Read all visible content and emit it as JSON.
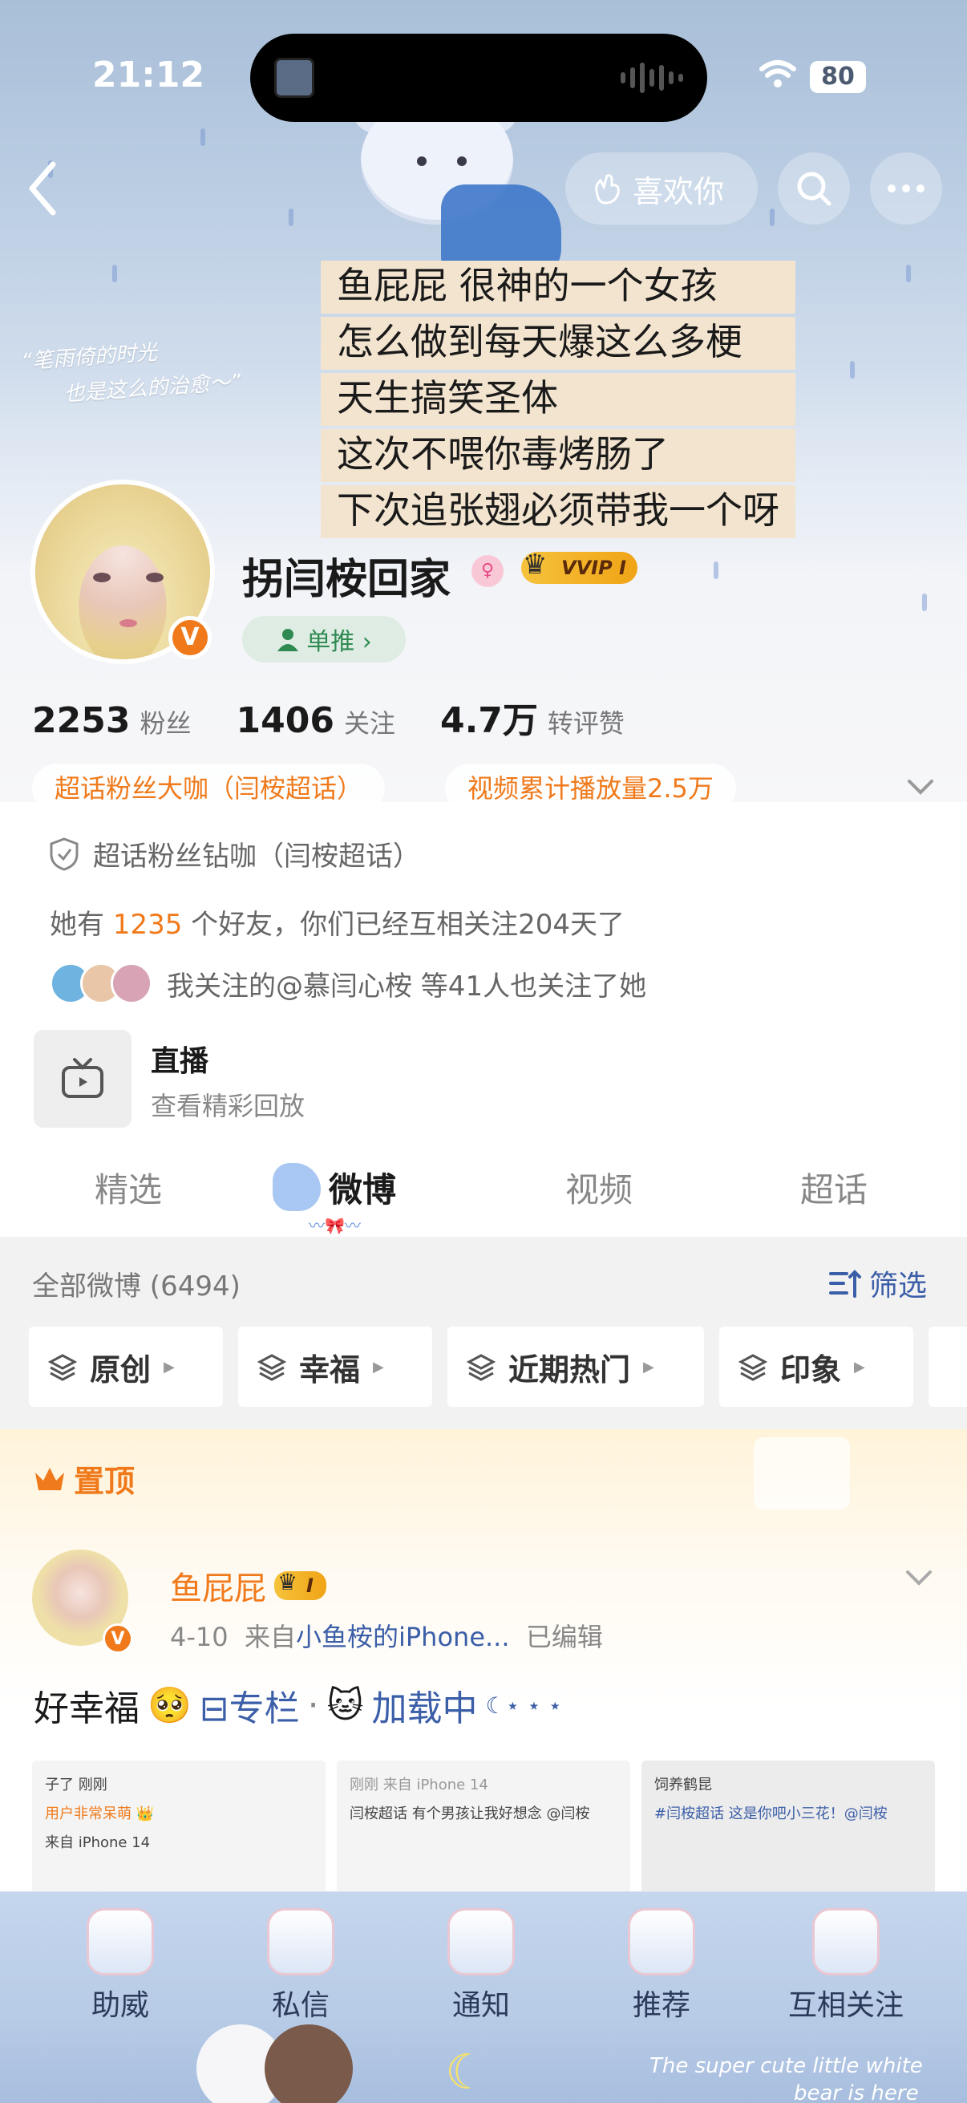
{
  "status_bar": {
    "time": "21:12",
    "battery": "80"
  },
  "banner": {
    "quote_lines": [
      "“笔雨倚的时光",
      "也是这么的治愈～”"
    ],
    "caption_lines": [
      "鱼屁屁 很神的一个女孩",
      "怎么做到每天爆这么多梗",
      "天生搞笑圣体",
      "这次不喂你毒烤肠了",
      "下次追张翅必须带我一个呀"
    ]
  },
  "top_nav": {
    "like_label": "喜欢你"
  },
  "profile": {
    "name": "拐闫桉回家",
    "vip_label": "VVIP I",
    "verified_mark": "V",
    "danxian_label": "单推 ›",
    "stats": [
      {
        "num": "2253",
        "label": "粉丝"
      },
      {
        "num": "1406",
        "label": "关注"
      },
      {
        "num": "4.7万",
        "label": "转评赞"
      }
    ],
    "tags": [
      "超话粉丝大咖（闫桉超话）",
      "视频累计播放量2.5万"
    ],
    "fan_badge": "超话粉丝钻咖（闫桉超话）",
    "friend_prefix": "她有",
    "friend_count": "1235",
    "friend_suffix": "个好友，你们已经互相关注204天了",
    "mutual_text": "我关注的@慕闫心桉 等41人也关注了她",
    "live_title": "直播",
    "live_subtitle": "查看精彩回放"
  },
  "tabs": [
    "精选",
    "微博",
    "视频",
    "超话"
  ],
  "feed": {
    "title": "全部微博 (6494)",
    "filter_label": "筛选",
    "chips": [
      "原创",
      "幸福",
      "近期热门",
      "印象"
    ]
  },
  "pinned": {
    "label": "置顶",
    "author": "鱼屁屁",
    "level_label": "I",
    "meta_date": "4-10",
    "meta_from": "来自",
    "meta_source": "小鱼桉的iPhone...",
    "meta_edited": "已编辑",
    "text": "好幸福",
    "emoji": "🥺",
    "column_label": "专栏",
    "dot": "·",
    "cat_emoji": "🐱",
    "loading_label": "加载中",
    "moon": "☾⋆ ⋆ ⋆",
    "thumbs": [
      {
        "lines": [
          "子了 刚刚",
          "用户非常呆萌 👑",
          "来自 iPhone 14"
        ]
      },
      {
        "lines": [
          "刚刚 来自 iPhone 14",
          "闫桉超话 有个男孩让我好想念 @闫桉"
        ]
      },
      {
        "lines": [
          "饲养鹤昆",
          "#闫桉超话 这是你吧小三花！@闫桉"
        ]
      }
    ]
  },
  "bottom_nav": [
    "助威",
    "私信",
    "通知",
    "推荐",
    "互相关注"
  ],
  "footer_text_lines": [
    "The super cute little white",
    "bear is here"
  ]
}
